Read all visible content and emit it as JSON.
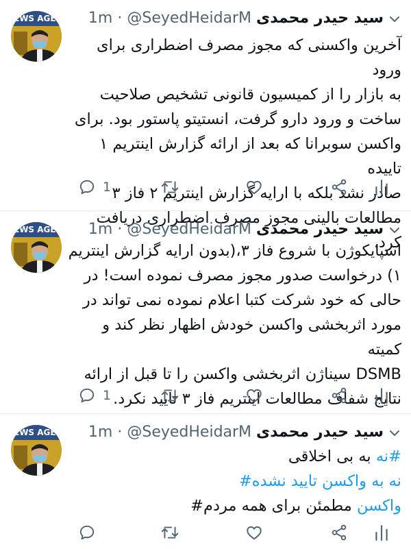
{
  "tweets": [
    {
      "author_name": "سید حیدر محمدی",
      "handle": "@SeyedHeidarM",
      "separator": "·",
      "time": "1m",
      "text": "آخرین واکسنی که مجوز مصرف اضطراری برای ورود\nبه بازار را از کمیسیون قانونی تشخیص صلاحیت\nساخت و ورود دارو گرفت، انستیتو پاستور بود. برای\nواکسن سوبرانا که بعد از ارائه گزارش اینتریم ۱ تاییده\nصادر نشد بلکه با ارایه گزارش اینتریم ۲ فاز ۳\nمطالعات بالینی مجوز مصرف اضطراری دریافت کرد.",
      "reply_count": "1"
    },
    {
      "author_name": "سید حیدر محمدی",
      "handle": "@SeyedHeidarM",
      "separator": "·",
      "time": "1m",
      "text": "اسپایکوژن با شروع فاز ۳،(بدون ارایه گزارش اینتریم\n۱) درخواست صدور مجوز مصرف نموده است! در\nحالی که خود شرکت کتبا اعلام نموده نمی تواند در\nمورد اثربخشی واکسن خودش اظهار نظر کند و کمیته\nDSMB سیناژن اثربخشی واکسن را تا قبل از ارائه\nنتایج شفاف مطالعات اینتریم فاز ۳ تایید نکرد.",
      "reply_count": "1"
    },
    {
      "author_name": "سید حیدر محمدی",
      "handle": "@SeyedHeidarM",
      "separator": "·",
      "time": "1m",
      "line1_hashtag": "#نه",
      "line1_rest": " به بی اخلاقی",
      "line2_hashtag": "نه به واکسن تایید نشده#",
      "line3_hashtag": "واکسن",
      "line3_rest": " مطمئن برای همه مردم#",
      "reply_count": ""
    }
  ],
  "colors": {
    "text": "#0f1419",
    "muted": "#536471",
    "link": "#1d9bf0",
    "divider": "#e6ecf0"
  },
  "icons": [
    "reply-icon",
    "retweet-icon",
    "like-icon",
    "share-icon",
    "analytics-icon",
    "more-caret-icon"
  ]
}
